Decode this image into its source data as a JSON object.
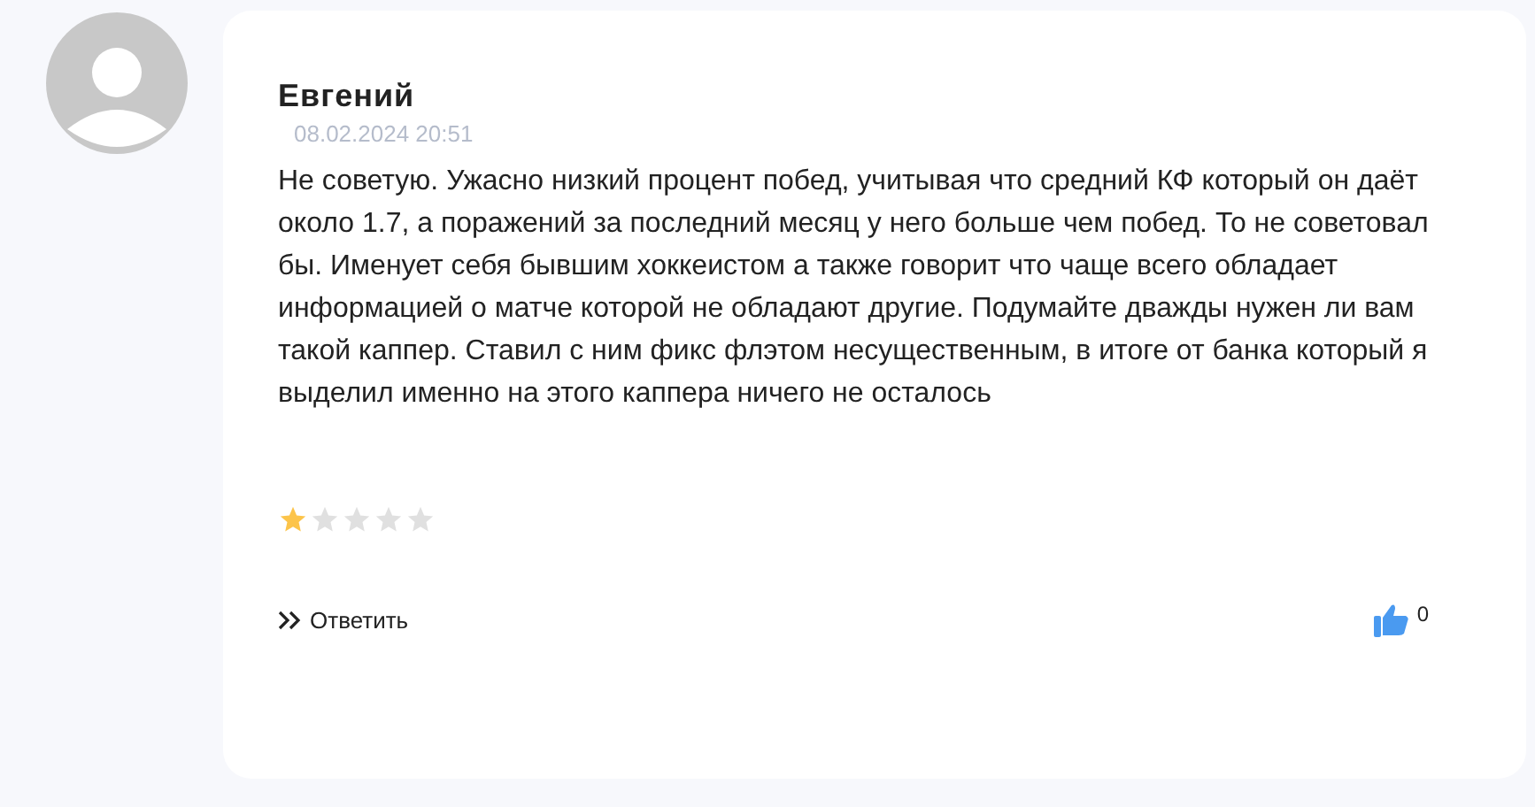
{
  "review": {
    "author": "Евгений",
    "date": "08.02.2024 20:51",
    "text": "Не советую. Ужасно низкий процент побед, учитывая что средний КФ который он даёт около 1.7, а поражений за последний месяц у него больше чем побед. То не советовал бы. Именует себя бывшим хоккеистом а также говорит что чаще всего обладает информацией о матче которой не обладают другие. Подумайте дважды нужен ли вам такой каппер. Ставил с ним фикс флэтом несущественным, в итоге от банка который я выделил именно на этого каппера ничего не осталось",
    "stars": 1,
    "reply": "Ответить",
    "likes": "0"
  }
}
